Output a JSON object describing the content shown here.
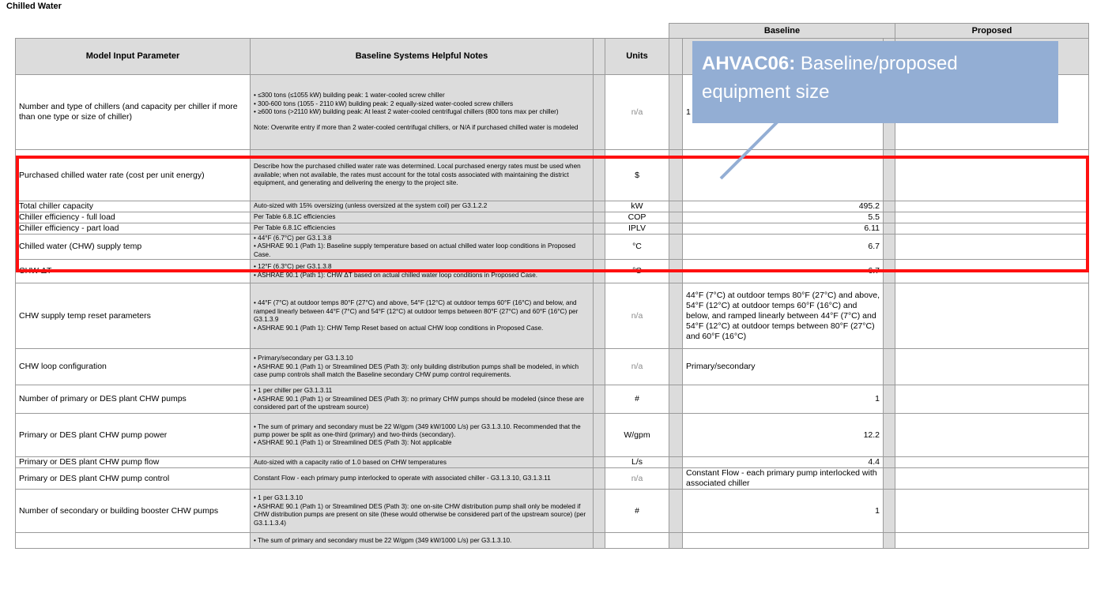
{
  "page_title": "Chilled Water",
  "top_headers": {
    "baseline": "Baseline",
    "proposed": "Proposed"
  },
  "headers": {
    "parameter": "Model Input Parameter",
    "notes": "Baseline Systems Helpful Notes",
    "units": "Units"
  },
  "rows": [
    {
      "param": "Number and type of chillers (and capacity per chiller if more than one type or size of chiller)",
      "notes": [
        "• ≤300 tons (≤1055 kW) building peak: 1 water-cooled screw chiller",
        "• 300-600 tons (1055 - 2110 kW) building peak: 2 equally-sized water-cooled  screw chillers",
        "• ≥600 tons (>2110 kW) building peak: At least 2 water-cooled centrifugal chillers (800 tons max per chiller)",
        "",
        "Note: Overwrite entry if more than 2 water-cooled centrifugal chillers, or N/A if purchased chilled water is modeled"
      ],
      "units": "n/a",
      "baseline": "1 w",
      "proposed": ""
    },
    {
      "param": "Purchased chilled water rate (cost per unit energy)",
      "notes": [
        "Describe how the purchased chilled water rate was determined. Local purchased energy rates must be used when available; when not available, the rates must account for the total costs associated with maintaining the district equipment, and generating and delivering the energy to the project site."
      ],
      "units": "$",
      "baseline": "",
      "proposed": ""
    },
    {
      "param": "Total chiller capacity",
      "notes": [
        "Auto-sized with 15% oversizing (unless oversized at the system coil) per G3.1.2.2"
      ],
      "units": "kW",
      "baseline": "495.2",
      "proposed": ""
    },
    {
      "param": "Chiller efficiency - full load",
      "notes": [
        "Per Table 6.8.1C efficiencies"
      ],
      "units": "COP",
      "baseline": "5.5",
      "proposed": ""
    },
    {
      "param": "Chiller efficiency - part load",
      "notes": [
        "Per Table 6.8.1C efficiencies"
      ],
      "units": "IPLV",
      "baseline": "6.11",
      "proposed": ""
    },
    {
      "param": "Chilled water (CHW) supply temp",
      "notes": [
        "• 44°F (6.7°C) per G3.1.3.8",
        "• ASHRAE 90.1 (Path 1): Baseline supply temperature based on actual chilled water loop conditions in Proposed Case."
      ],
      "units": "°C",
      "baseline": "6.7",
      "proposed": ""
    },
    {
      "param": "CHW ΔT",
      "notes": [
        "• 12°F (6.3°C) per  G3.1.3.8",
        "• ASHRAE 90.1 (Path 1): CHW ΔT  based on actual chilled water loop conditions in Proposed Case."
      ],
      "units": "°C",
      "baseline": "6.7",
      "proposed": ""
    },
    {
      "param": "CHW supply temp reset parameters",
      "notes": [
        "• 44°F (7°C) at outdoor temps 80°F (27°C) and above, 54°F (12°C) at outdoor temps 60°F (16°C) and below, and ramped linearly between 44°F (7°C) and 54°F (12°C) at outdoor temps between 80°F (27°C) and 60°F (16°C) per G3.1.3.9",
        "• ASHRAE 90.1 (Path 1): CHW Temp Reset based on actual CHW loop conditions in Proposed Case."
      ],
      "units": "n/a",
      "baseline": "44°F (7°C) at outdoor temps 80°F (27°C) and above, 54°F (12°C) at outdoor temps 60°F (16°C) and below, and ramped linearly between 44°F (7°C) and 54°F (12°C) at outdoor temps between 80°F (27°C) and 60°F (16°C)",
      "proposed": ""
    },
    {
      "param": "CHW loop configuration",
      "notes": [
        "• Primary/secondary per G3.1.3.10",
        "• ASHRAE 90.1 (Path 1) or Streamlined DES (Path 3): only building distribution pumps shall be modeled, in which case pump controls shall match the Baseline secondary CHW pump control requirements."
      ],
      "units": "n/a",
      "baseline": "Primary/secondary",
      "proposed": ""
    },
    {
      "param": "Number of primary or DES plant CHW pumps",
      "notes": [
        "• 1 per chiller per G3.1.3.11",
        "• ASHRAE 90.1 (Path 1) or Streamlined DES (Path 3): no primary  CHW pumps should be modeled (since these are considered part of the upstream source)"
      ],
      "units": "#",
      "baseline": "1",
      "proposed": ""
    },
    {
      "param": "Primary or DES plant CHW pump power",
      "notes": [
        "• The sum of primary and secondary must be 22 W/gpm (349 kW/1000 L/s) per G3.1.3.10. Recommended that the pump power be split as one-third (primary) and two-thirds (secondary).",
        "• ASHRAE 90.1 (Path 1) or Streamlined DES (Path 3): Not applicable"
      ],
      "units": "W/gpm",
      "baseline": "12.2",
      "proposed": ""
    },
    {
      "param": "Primary or DES plant CHW pump flow",
      "notes": [
        "Auto-sized with a capacity ratio of 1.0 based on CHW temperatures"
      ],
      "units": "L/s",
      "baseline": "4.4",
      "proposed": ""
    },
    {
      "param": "Primary or DES plant CHW pump control",
      "notes": [
        "Constant Flow - each primary pump interlocked to operate with associated chiller - G3.1.3.10, G3.1.3.11"
      ],
      "units": "n/a",
      "baseline": "Constant Flow - each primary pump interlocked with associated chiller",
      "proposed": ""
    },
    {
      "param": "Number of secondary or building booster CHW pumps",
      "notes": [
        "• 1 per G3.1.3.10",
        "• ASHRAE 90.1 (Path 1) or Streamlined DES (Path 3): one on-site CHW distribution pump shall only be modeled if CHW distribution pumps are present on site (these would otherwise be considered part of the upstream source) (per G3.1.1.3.4)"
      ],
      "units": "#",
      "baseline": "1",
      "proposed": ""
    },
    {
      "param": "",
      "notes": [
        "• The sum of primary and secondary must be 22 W/gpm (349 kW/1000 L/s) per G3.1.3.10."
      ],
      "units": "",
      "baseline": "",
      "proposed": ""
    }
  ],
  "callout": {
    "code": "AHVAC06:",
    "text": " Baseline/proposed equipment size"
  }
}
